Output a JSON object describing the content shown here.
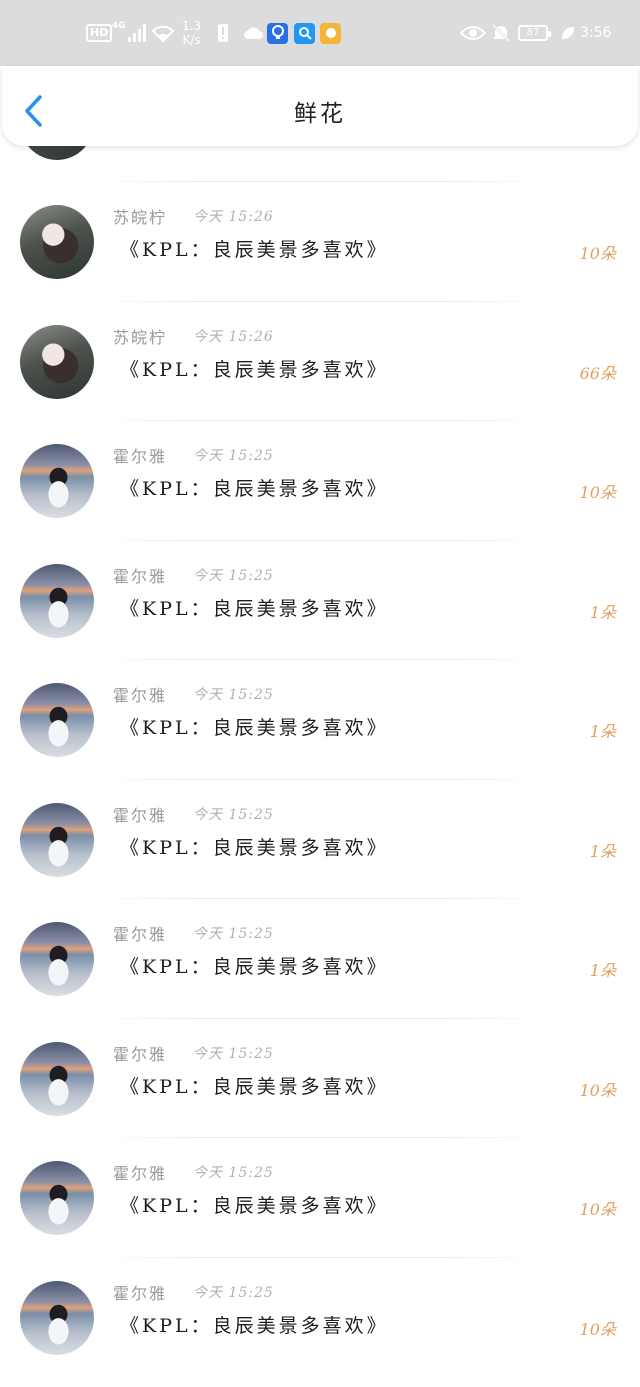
{
  "status_bar": {
    "hd": "HD",
    "network": "4G",
    "speed_value": "1.3",
    "speed_unit": "K/s",
    "battery": "87",
    "time": "3:56"
  },
  "header": {
    "title": "鲜花"
  },
  "colors": {
    "accent": "#2a8ff0",
    "count": "#e0a060",
    "status_bar_bg": "#dcdcdc"
  },
  "records": [
    {
      "name": "苏皖柠",
      "time": "今天 15:26",
      "message": "《KPL：良辰美景多喜欢》",
      "count": "10朵",
      "avatar": "girl-portrait"
    },
    {
      "name": "苏皖柠",
      "time": "今天 15:26",
      "message": "《KPL：良辰美景多喜欢》",
      "count": "66朵",
      "avatar": "girl-portrait"
    },
    {
      "name": "霍尔雅",
      "time": "今天 15:25",
      "message": "《KPL：良辰美景多喜欢》",
      "count": "10朵",
      "avatar": "girl-by-sea"
    },
    {
      "name": "霍尔雅",
      "time": "今天 15:25",
      "message": "《KPL：良辰美景多喜欢》",
      "count": "1朵",
      "avatar": "girl-by-sea"
    },
    {
      "name": "霍尔雅",
      "time": "今天 15:25",
      "message": "《KPL：良辰美景多喜欢》",
      "count": "1朵",
      "avatar": "girl-by-sea"
    },
    {
      "name": "霍尔雅",
      "time": "今天 15:25",
      "message": "《KPL：良辰美景多喜欢》",
      "count": "1朵",
      "avatar": "girl-by-sea"
    },
    {
      "name": "霍尔雅",
      "time": "今天 15:25",
      "message": "《KPL：良辰美景多喜欢》",
      "count": "1朵",
      "avatar": "girl-by-sea"
    },
    {
      "name": "霍尔雅",
      "time": "今天 15:25",
      "message": "《KPL：良辰美景多喜欢》",
      "count": "10朵",
      "avatar": "girl-by-sea"
    },
    {
      "name": "霍尔雅",
      "time": "今天 15:25",
      "message": "《KPL：良辰美景多喜欢》",
      "count": "10朵",
      "avatar": "girl-by-sea"
    },
    {
      "name": "霍尔雅",
      "time": "今天 15:25",
      "message": "《KPL：良辰美景多喜欢》",
      "count": "10朵",
      "avatar": "girl-by-sea"
    }
  ]
}
